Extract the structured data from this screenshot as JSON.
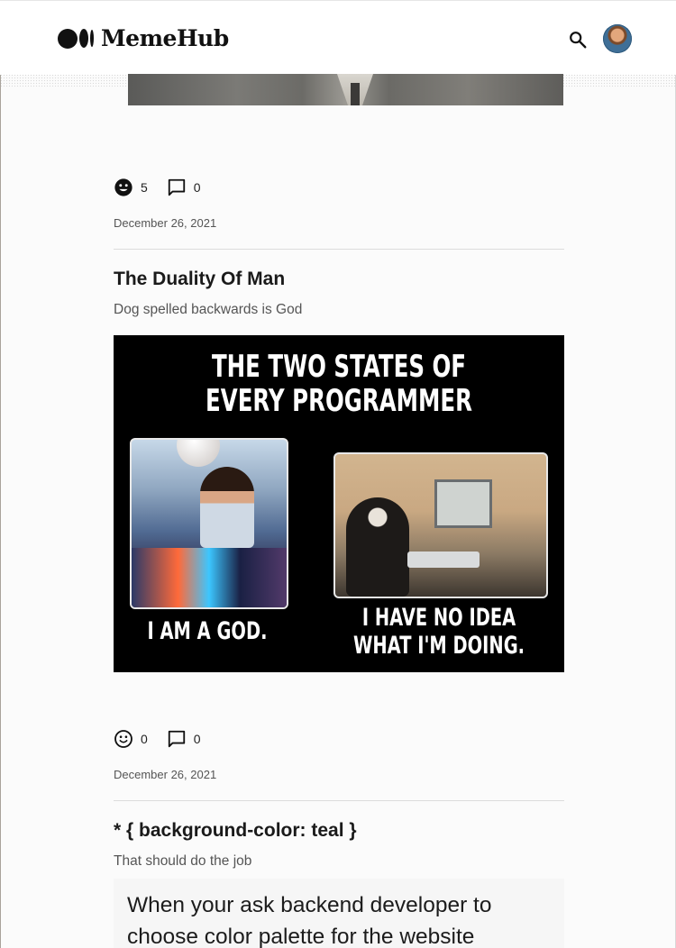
{
  "header": {
    "brand": "MemeHub",
    "search_icon": "search-icon",
    "avatar_icon": "user-avatar"
  },
  "posts": [
    {
      "reactions": {
        "smile_count": "5",
        "comment_count": "0"
      },
      "date": "December 26, 2021"
    },
    {
      "title": "The Duality Of Man",
      "subtitle": "Dog spelled backwards is God",
      "image": {
        "headline_1": "THE TWO STATES OF",
        "headline_2": "EVERY PROGRAMMER",
        "caption_left": "I AM A GOD.",
        "caption_right_1": "I HAVE NO IDEA",
        "caption_right_2": "WHAT I'M DOING."
      },
      "reactions": {
        "smile_count": "0",
        "comment_count": "0"
      },
      "date": "December 26, 2021"
    },
    {
      "title": "* { background-color: teal }",
      "subtitle": "That should do the job",
      "image": {
        "line_1": "When your ask backend developer to",
        "line_2": "choose color palette for the website"
      }
    }
  ],
  "colors": {
    "page_bg": "#fbfbfb",
    "text": "#1a1a1a",
    "muted": "#555555",
    "divider": "#dcdcdc"
  }
}
